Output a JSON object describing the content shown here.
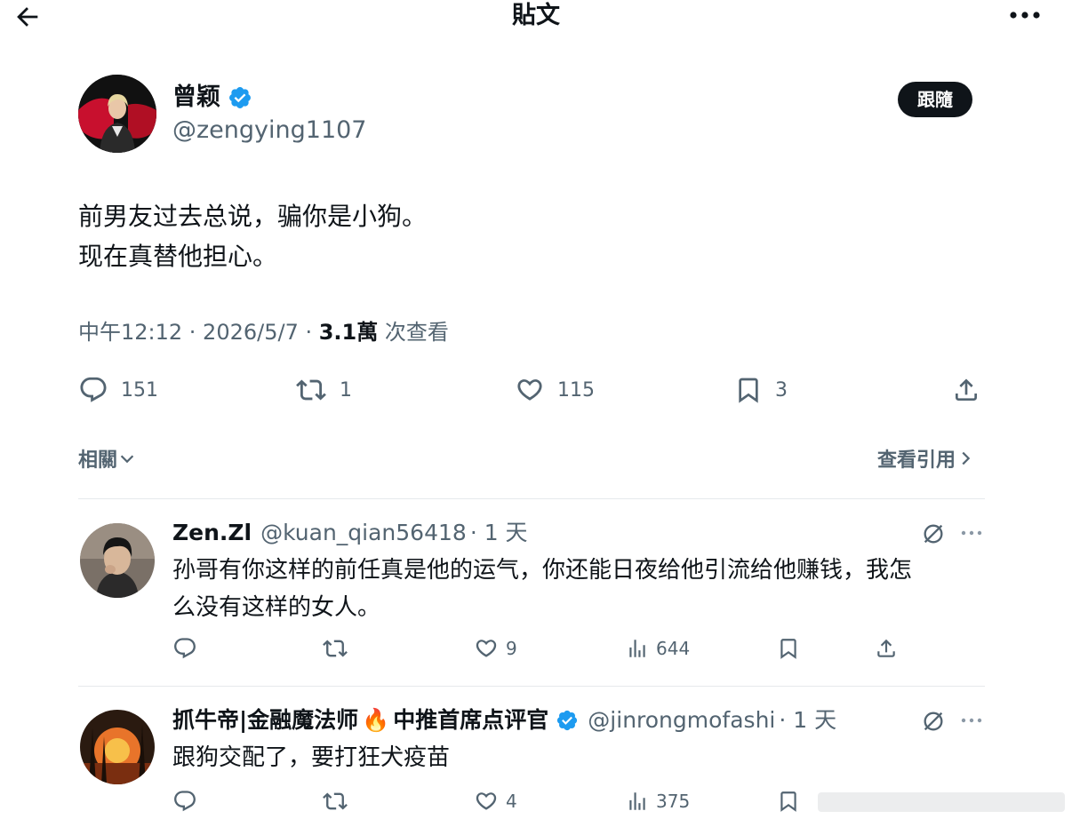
{
  "header": {
    "title": "貼文"
  },
  "author": {
    "name": "曾颖",
    "handle": "@zengying1107",
    "follow_label": "跟隨"
  },
  "tweet": {
    "lines": [
      "前男友过去总说，骗你是小狗。",
      "现在真替他担心。"
    ],
    "time": "中午12:12 · 2026/5/7 · ",
    "views": "3.1萬",
    "views_suffix": " 次查看",
    "counts": {
      "replies": "151",
      "retweets": "1",
      "likes": "115",
      "bookmarks": "3"
    }
  },
  "related": {
    "label": "相關"
  },
  "quotes": {
    "label": "查看引用"
  },
  "replies": [
    {
      "name": "Zen.Zl",
      "handle": "@kuan_qian56418",
      "time": "· 1 天",
      "text_line1": "孙哥有你这样的前任真是他的运气，你还能日夜给他引流给他赚钱，我怎",
      "text_line2": "么没有这样的女人。",
      "likes": "9",
      "views": "644"
    },
    {
      "name": "抓牛帝|金融魔法师",
      "name_emoji": "🔥",
      "name_suffix": "中推首席点评官",
      "handle": "@jinrongmofashi",
      "time": "· 1 天",
      "text": "跟狗交配了，要打狂犬疫苗",
      "likes": "4",
      "views": "375"
    }
  ],
  "icons": {
    "back": "arrow-left-icon",
    "more": "more-horizontal-icon",
    "verified": "verified-badge-icon",
    "reply": "chat-bubble-icon",
    "retweet": "repost-icon",
    "like": "heart-icon",
    "bookmark": "bookmark-icon",
    "share": "share-up-arrow-icon",
    "analytics": "bar-chart-icon",
    "grok": "grok-slash-circle-icon"
  },
  "colors": {
    "text": "#0f1419",
    "secondary": "#536471",
    "verified": "#1d9bf0",
    "divider": "#e6e9ec"
  }
}
